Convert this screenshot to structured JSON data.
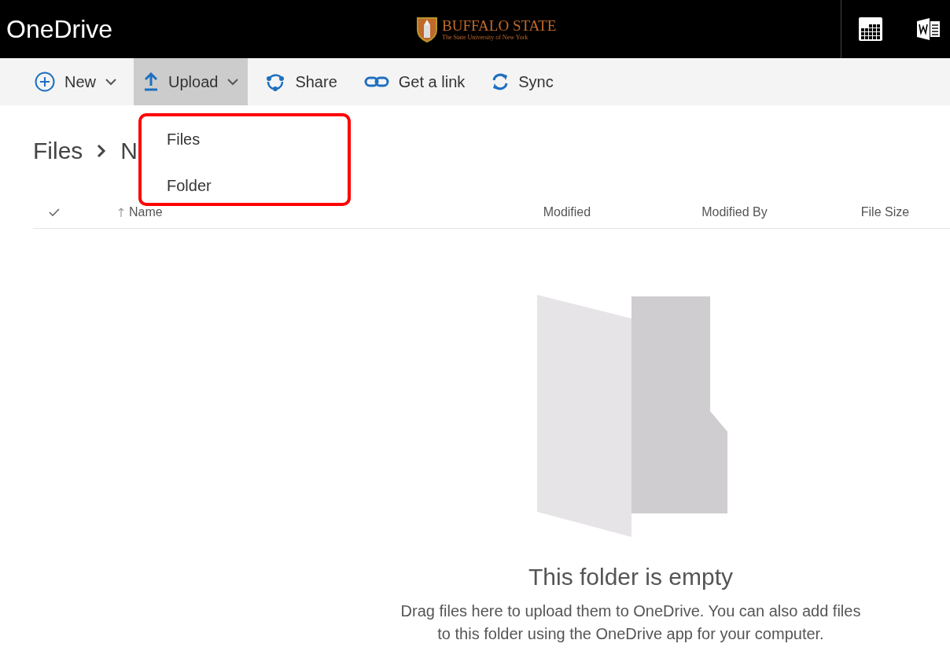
{
  "header": {
    "app_name": "OneDrive",
    "logo": {
      "name": "BUFFALO STATE",
      "subtitle": "The State University of New York"
    }
  },
  "toolbar": [
    {
      "kind": "new",
      "label": "New",
      "dropdown": true,
      "selected": false
    },
    {
      "kind": "upload",
      "label": "Upload",
      "dropdown": true,
      "selected": true
    },
    {
      "kind": "share",
      "label": "Share",
      "dropdown": false,
      "selected": false
    },
    {
      "kind": "link",
      "label": "Get a link",
      "dropdown": false,
      "selected": false
    },
    {
      "kind": "sync",
      "label": "Sync",
      "dropdown": false,
      "selected": false
    }
  ],
  "upload_menu": {
    "highlighted": true,
    "items": [
      "Files",
      "Folder"
    ]
  },
  "breadcrumb": [
    "Files",
    "N"
  ],
  "columns": [
    "Name",
    "Modified",
    "Modified By",
    "File Size"
  ],
  "empty_state": {
    "title": "This folder is empty",
    "message": "Drag files here to upload them to OneDrive. You can also add files to this folder using the OneDrive app for your computer."
  }
}
